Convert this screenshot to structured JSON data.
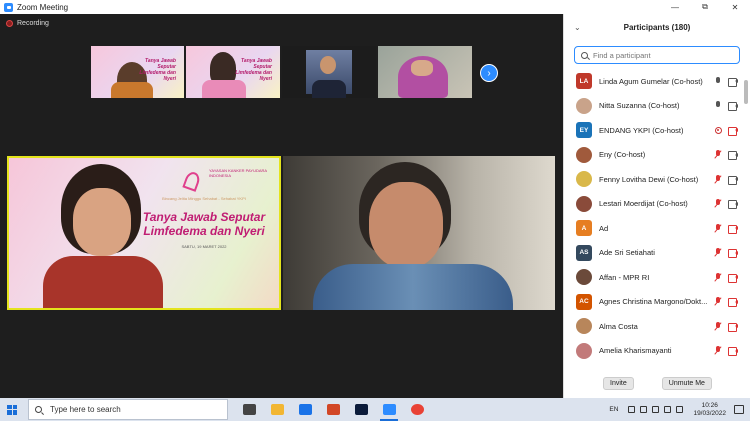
{
  "window": {
    "title": "Zoom Meeting"
  },
  "recording": {
    "label": "Recording"
  },
  "thumbnails": [
    {
      "type": "slide",
      "banner": "Tanya Jawab Seputar Limfedema dan Nyeri"
    },
    {
      "type": "slide",
      "banner": "Tanya Jawab Seputar Limfedema dan Nyeri"
    },
    {
      "type": "person"
    },
    {
      "type": "person"
    }
  ],
  "main_slide": {
    "org": "YAYASAN KANKER PAYUDARA INDONESIA",
    "subtitle": "Bincang Jelita Minggu Sehabat - Sehabat YKPI",
    "title_line1": "Tanya Jawab Seputar",
    "title_line2": "Limfedema dan Nyeri",
    "date": "SABTU, 19 MARET 2022"
  },
  "participants_panel": {
    "title": "Participants (180)",
    "search_placeholder": "Find a participant",
    "participants": [
      {
        "initials": "LA",
        "color": "#c0392b",
        "name": "Linda Agum Gumelar (Co-host)",
        "mic": "on",
        "cam": "on",
        "photo": false
      },
      {
        "initials": "",
        "color": "#c9a38a",
        "name": "Nitta Suzanna (Co-host)",
        "mic": "on",
        "cam": "on",
        "photo": true
      },
      {
        "initials": "EY",
        "color": "#1a73b8",
        "name": "ENDANG YKPI (Co-host)",
        "mic": "rec",
        "cam": "off",
        "photo": false
      },
      {
        "initials": "",
        "color": "#a05a3c",
        "name": "Eny (Co-host)",
        "mic": "muted",
        "cam": "on",
        "photo": true
      },
      {
        "initials": "",
        "color": "#d9b84a",
        "name": "Fenny Lovitha Dewi (Co-host)",
        "mic": "muted",
        "cam": "on",
        "photo": true
      },
      {
        "initials": "",
        "color": "#8a4b3a",
        "name": "Lestari Moerdijat (Co-host)",
        "mic": "muted",
        "cam": "on",
        "photo": true
      },
      {
        "initials": "A",
        "color": "#e67e22",
        "name": "Ad",
        "mic": "muted",
        "cam": "off",
        "photo": false
      },
      {
        "initials": "AS",
        "color": "#34495e",
        "name": "Ade Sri Setiahati",
        "mic": "muted",
        "cam": "off",
        "photo": false
      },
      {
        "initials": "",
        "color": "#6b4a3a",
        "name": "Affan - MPR RI",
        "mic": "muted",
        "cam": "off",
        "photo": true
      },
      {
        "initials": "AC",
        "color": "#d35400",
        "name": "Agnes Christina Margono/Dokt...",
        "mic": "muted",
        "cam": "off",
        "photo": false
      },
      {
        "initials": "",
        "color": "#b8865b",
        "name": "Alma Costa",
        "mic": "muted",
        "cam": "off",
        "photo": true
      },
      {
        "initials": "",
        "color": "#c27a7a",
        "name": "Amelia Kharismayanti",
        "mic": "muted",
        "cam": "off",
        "photo": true
      },
      {
        "initials": "",
        "color": "#7a5a4a",
        "name": "",
        "mic": "muted",
        "cam": "off",
        "photo": true
      }
    ],
    "invite_label": "Invite",
    "unmute_label": "Unmute Me"
  },
  "taskbar": {
    "search_placeholder": "Type here to search",
    "apps": [
      {
        "icon": "task-view-icon",
        "color": "#444444"
      },
      {
        "icon": "file-explorer-icon",
        "color": "#f2b632"
      },
      {
        "icon": "mail-icon",
        "color": "#1a73e8"
      },
      {
        "icon": "powerpoint-icon",
        "color": "#d24726"
      },
      {
        "icon": "photoshop-icon",
        "color": "#0b1b3a"
      },
      {
        "icon": "zoom-icon",
        "color": "#2d8cff"
      },
      {
        "icon": "chrome-icon",
        "color": "#e94235"
      }
    ],
    "language": "EN",
    "time": "10:26",
    "date": "19/03/2022"
  }
}
